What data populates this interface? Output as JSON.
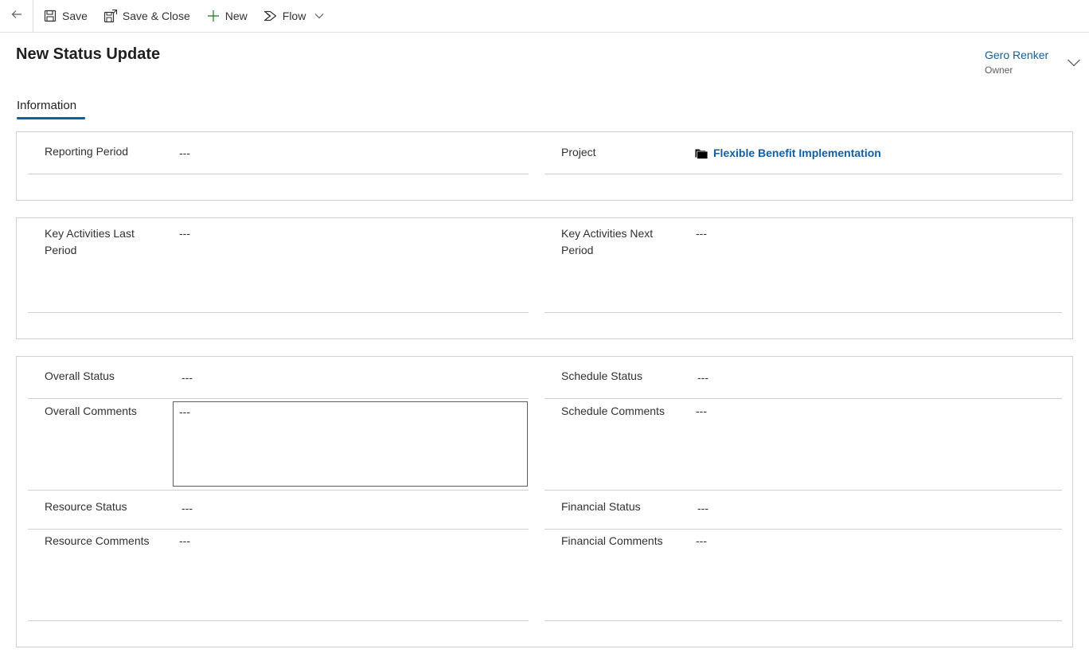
{
  "toolbar": {
    "save_label": "Save",
    "save_close_label": "Save & Close",
    "new_label": "New",
    "flow_label": "Flow"
  },
  "header": {
    "title": "New Status Update",
    "owner_name": "Gero Renker",
    "owner_label": "Owner"
  },
  "tabs": [
    {
      "label": "Information",
      "active": true
    }
  ],
  "section1": {
    "reporting_period": {
      "label": "Reporting Period",
      "value": "---"
    },
    "project": {
      "label": "Project",
      "value": "Flexible Benefit Implementation"
    }
  },
  "section2": {
    "key_activities_last": {
      "label": "Key Activities Last Period",
      "value": "---"
    },
    "key_activities_next": {
      "label": "Key Activities Next Period",
      "value": "---"
    }
  },
  "section3": {
    "overall_status": {
      "label": "Overall Status",
      "value": "---"
    },
    "schedule_status": {
      "label": "Schedule Status",
      "value": "---"
    },
    "overall_comments": {
      "label": "Overall Comments",
      "value": "---"
    },
    "schedule_comments": {
      "label": "Schedule Comments",
      "value": "---"
    },
    "resource_status": {
      "label": "Resource Status",
      "value": "---"
    },
    "financial_status": {
      "label": "Financial Status",
      "value": "---"
    },
    "resource_comments": {
      "label": "Resource Comments",
      "value": "---"
    },
    "financial_comments": {
      "label": "Financial Comments",
      "value": "---"
    }
  },
  "colors": {
    "accent": "#115ea3",
    "border": "#d2d0ce",
    "new_icon": "#107c10"
  },
  "icons": [
    "back-arrow-icon",
    "save-icon",
    "save-close-icon",
    "plus-icon",
    "flow-icon",
    "chevron-down-icon",
    "folder-icon"
  ]
}
